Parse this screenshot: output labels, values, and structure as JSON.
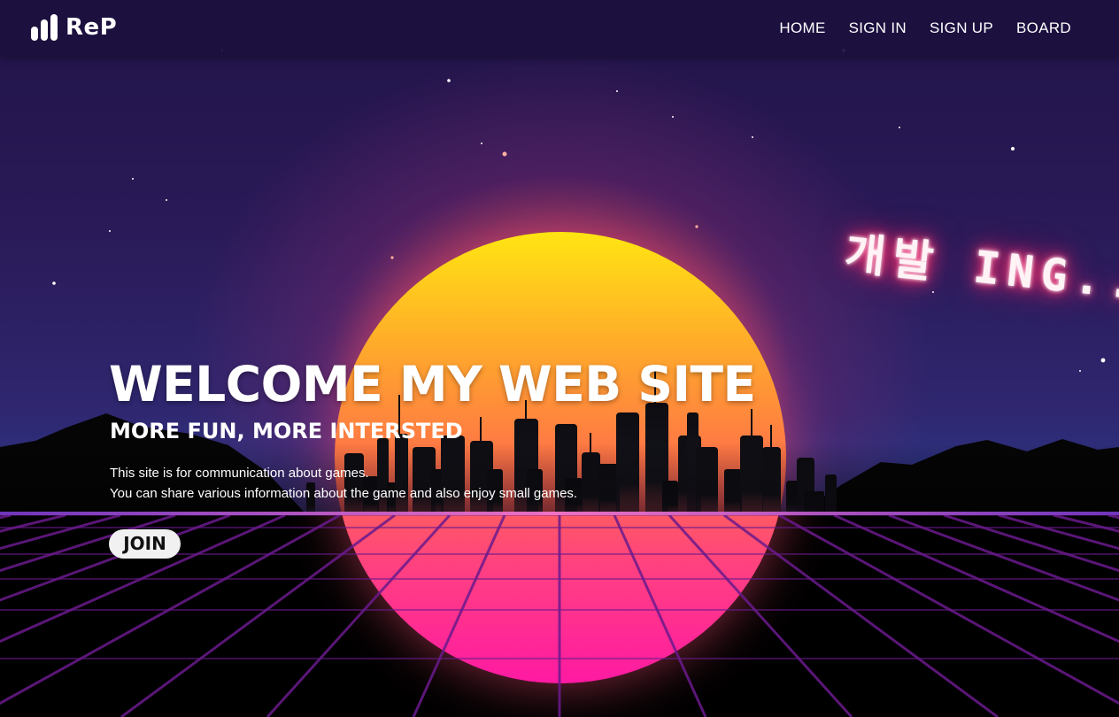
{
  "header": {
    "logo_text": "ReP",
    "logo_icon": "bar-chart-icon",
    "nav": [
      {
        "label": "HOME"
      },
      {
        "label": "SIGN IN"
      },
      {
        "label": "SIGN UP"
      },
      {
        "label": "BOARD"
      }
    ]
  },
  "hero": {
    "title": "WELCOME MY WEB SITE",
    "subtitle": "MORE FUN, MORE INTERSTED",
    "description_line1": "This site is for communication about games.",
    "description_line2": "You can share various information about the game and also enjoy small games.",
    "join_label": "JOIN"
  },
  "neon_sign": "개발 ING...",
  "colors": {
    "header_bg": "#1c103e",
    "sky_top": "#211348",
    "sun_top": "#ffe512",
    "sun_bottom": "#ff1aa2",
    "grid_line": "#6a1a8c",
    "neon_glow": "#ff2f6f"
  }
}
